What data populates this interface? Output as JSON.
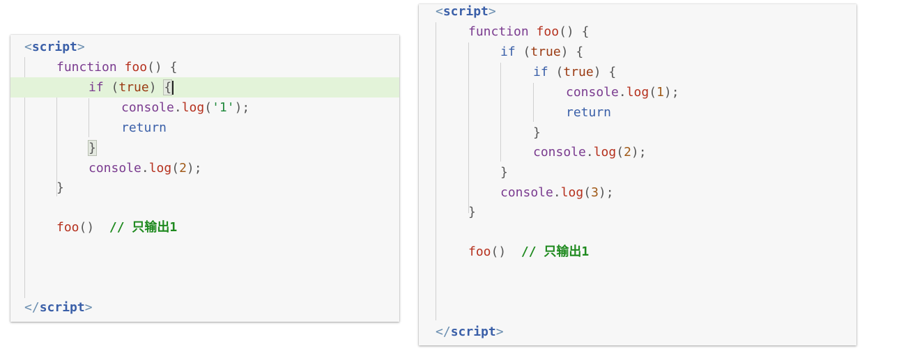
{
  "left_panel": {
    "open_tag": "script",
    "close_tag": "script",
    "function_kw": "function",
    "function_name": "foo",
    "if_kw": "if",
    "if_cond": "true",
    "log_obj": "console",
    "log_method": "log",
    "log_1_arg": "'1'",
    "return_kw": "return",
    "log_2_arg": "2",
    "call_name": "foo",
    "comment": "// 只输出1"
  },
  "right_panel": {
    "open_tag": "script",
    "close_tag": "script",
    "function_kw": "function",
    "function_name": "foo",
    "if_kw": "if",
    "if_cond": "true",
    "log_obj": "console",
    "log_method": "log",
    "log_1_arg": "1",
    "return_kw": "return",
    "log_2_arg": "2",
    "log_3_arg": "3",
    "call_name": "foo",
    "comment": "// 只输出1"
  }
}
